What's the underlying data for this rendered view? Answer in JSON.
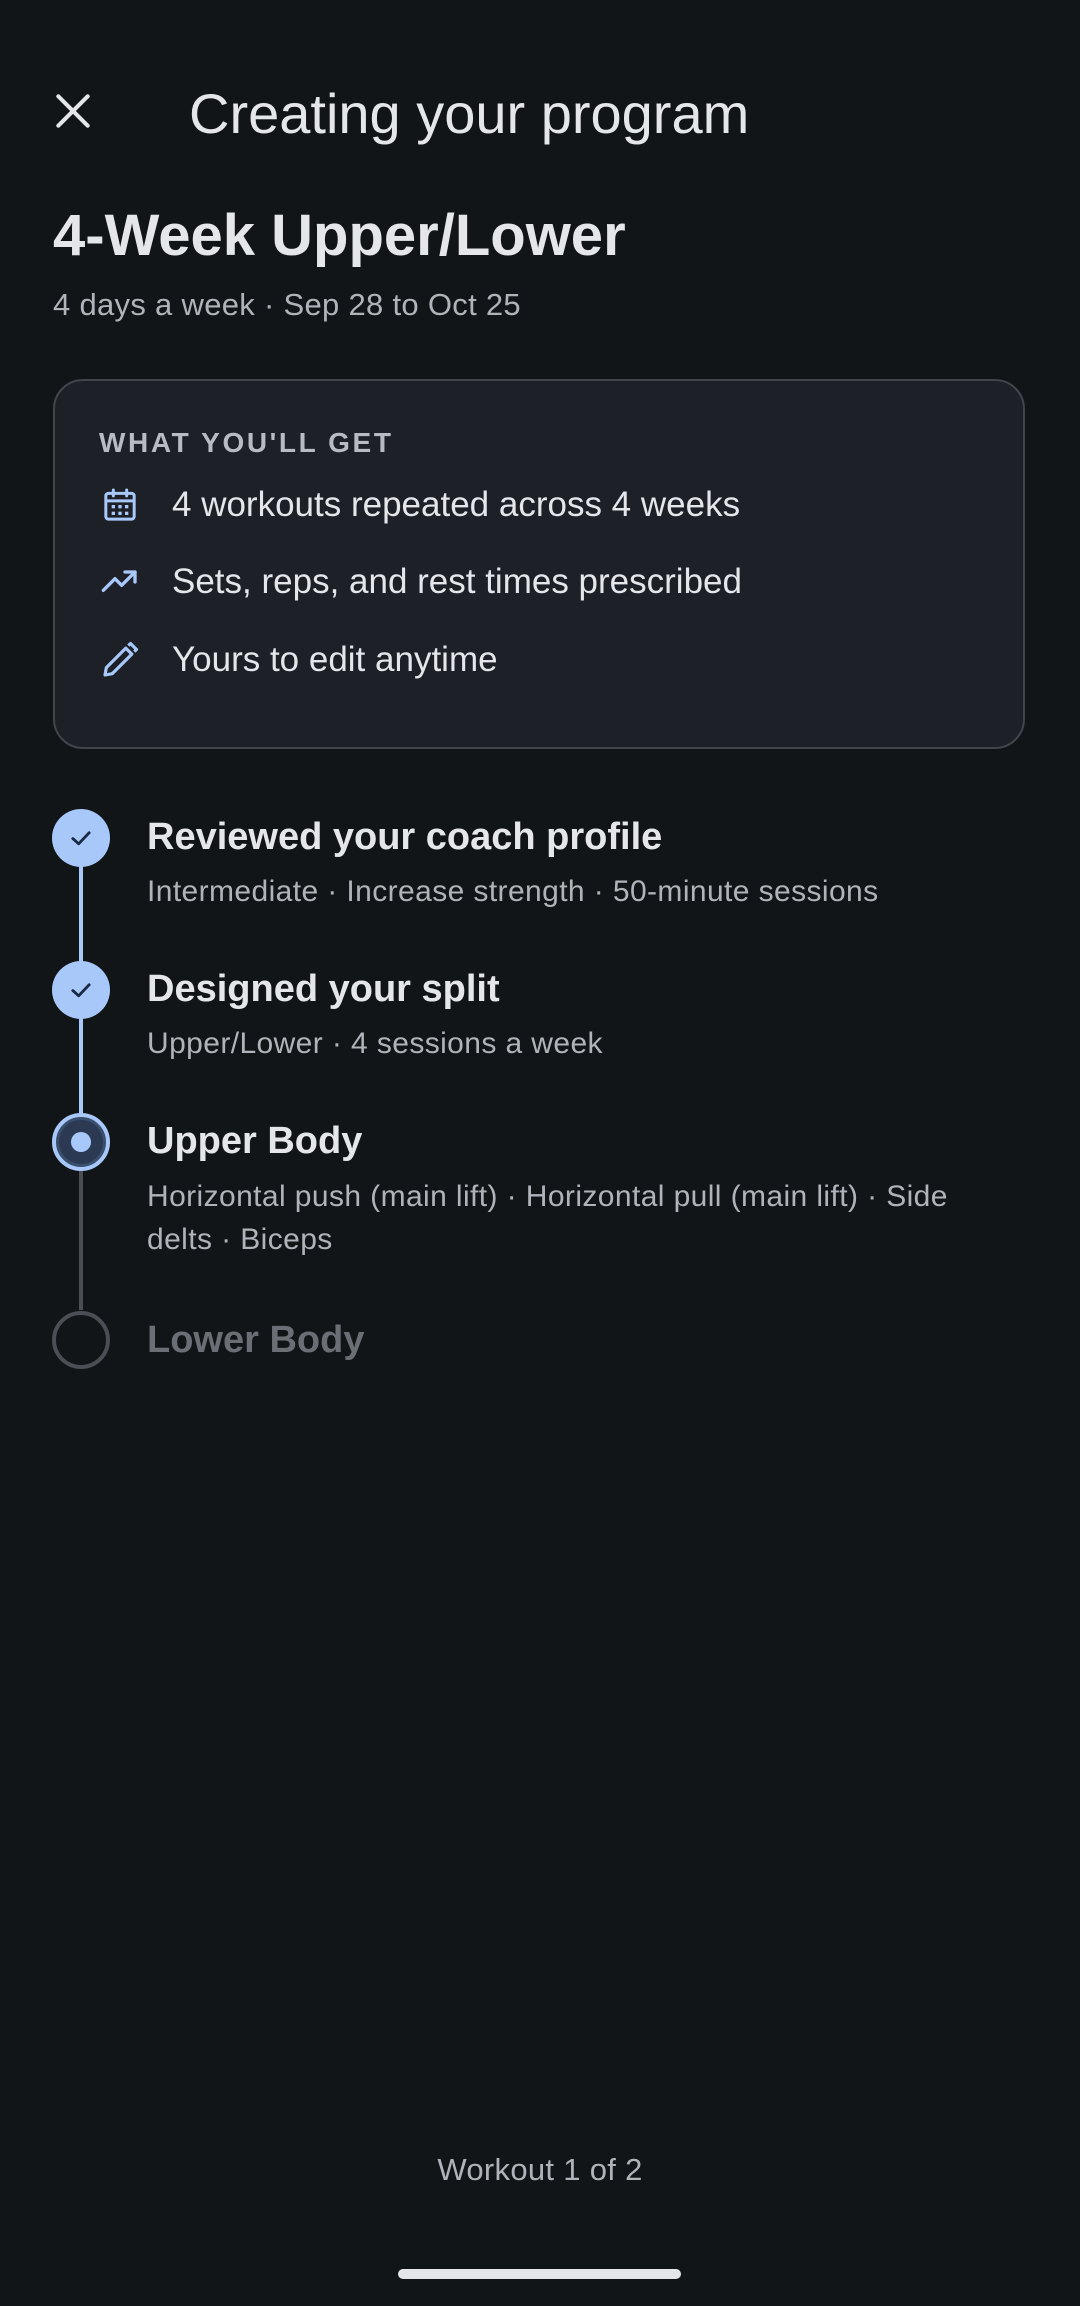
{
  "header": {
    "title": "Creating your program",
    "close_icon": "close-icon"
  },
  "program": {
    "title": "4-Week Upper/Lower",
    "subtitle": "4 days a week · Sep 28 to Oct 25"
  },
  "benefits_card": {
    "heading": "WHAT YOU'LL GET",
    "items": [
      {
        "icon": "calendar-icon",
        "label": "4 workouts repeated across 4 weeks"
      },
      {
        "icon": "trending-up-icon",
        "label": "Sets, reps, and rest times prescribed"
      },
      {
        "icon": "pencil-icon",
        "label": "Yours to edit anytime"
      }
    ]
  },
  "steps": [
    {
      "status": "done",
      "title": "Reviewed your coach profile",
      "description": "Intermediate · Increase strength · 50-minute sessions"
    },
    {
      "status": "done",
      "title": "Designed your split",
      "description": "Upper/Lower · 4 sessions a week"
    },
    {
      "status": "active",
      "title": "Upper Body",
      "description": "Horizontal push (main lift) · Horizontal pull (main lift) · Side delts · Biceps"
    },
    {
      "status": "pending",
      "title": "Lower Body",
      "description": ""
    }
  ],
  "footer": {
    "status": "Workout 1 of 2"
  },
  "colors": {
    "background": "#121518",
    "accent": "#a8c8fa",
    "card_background": "#1d2027",
    "pending": "#4a4e55"
  }
}
